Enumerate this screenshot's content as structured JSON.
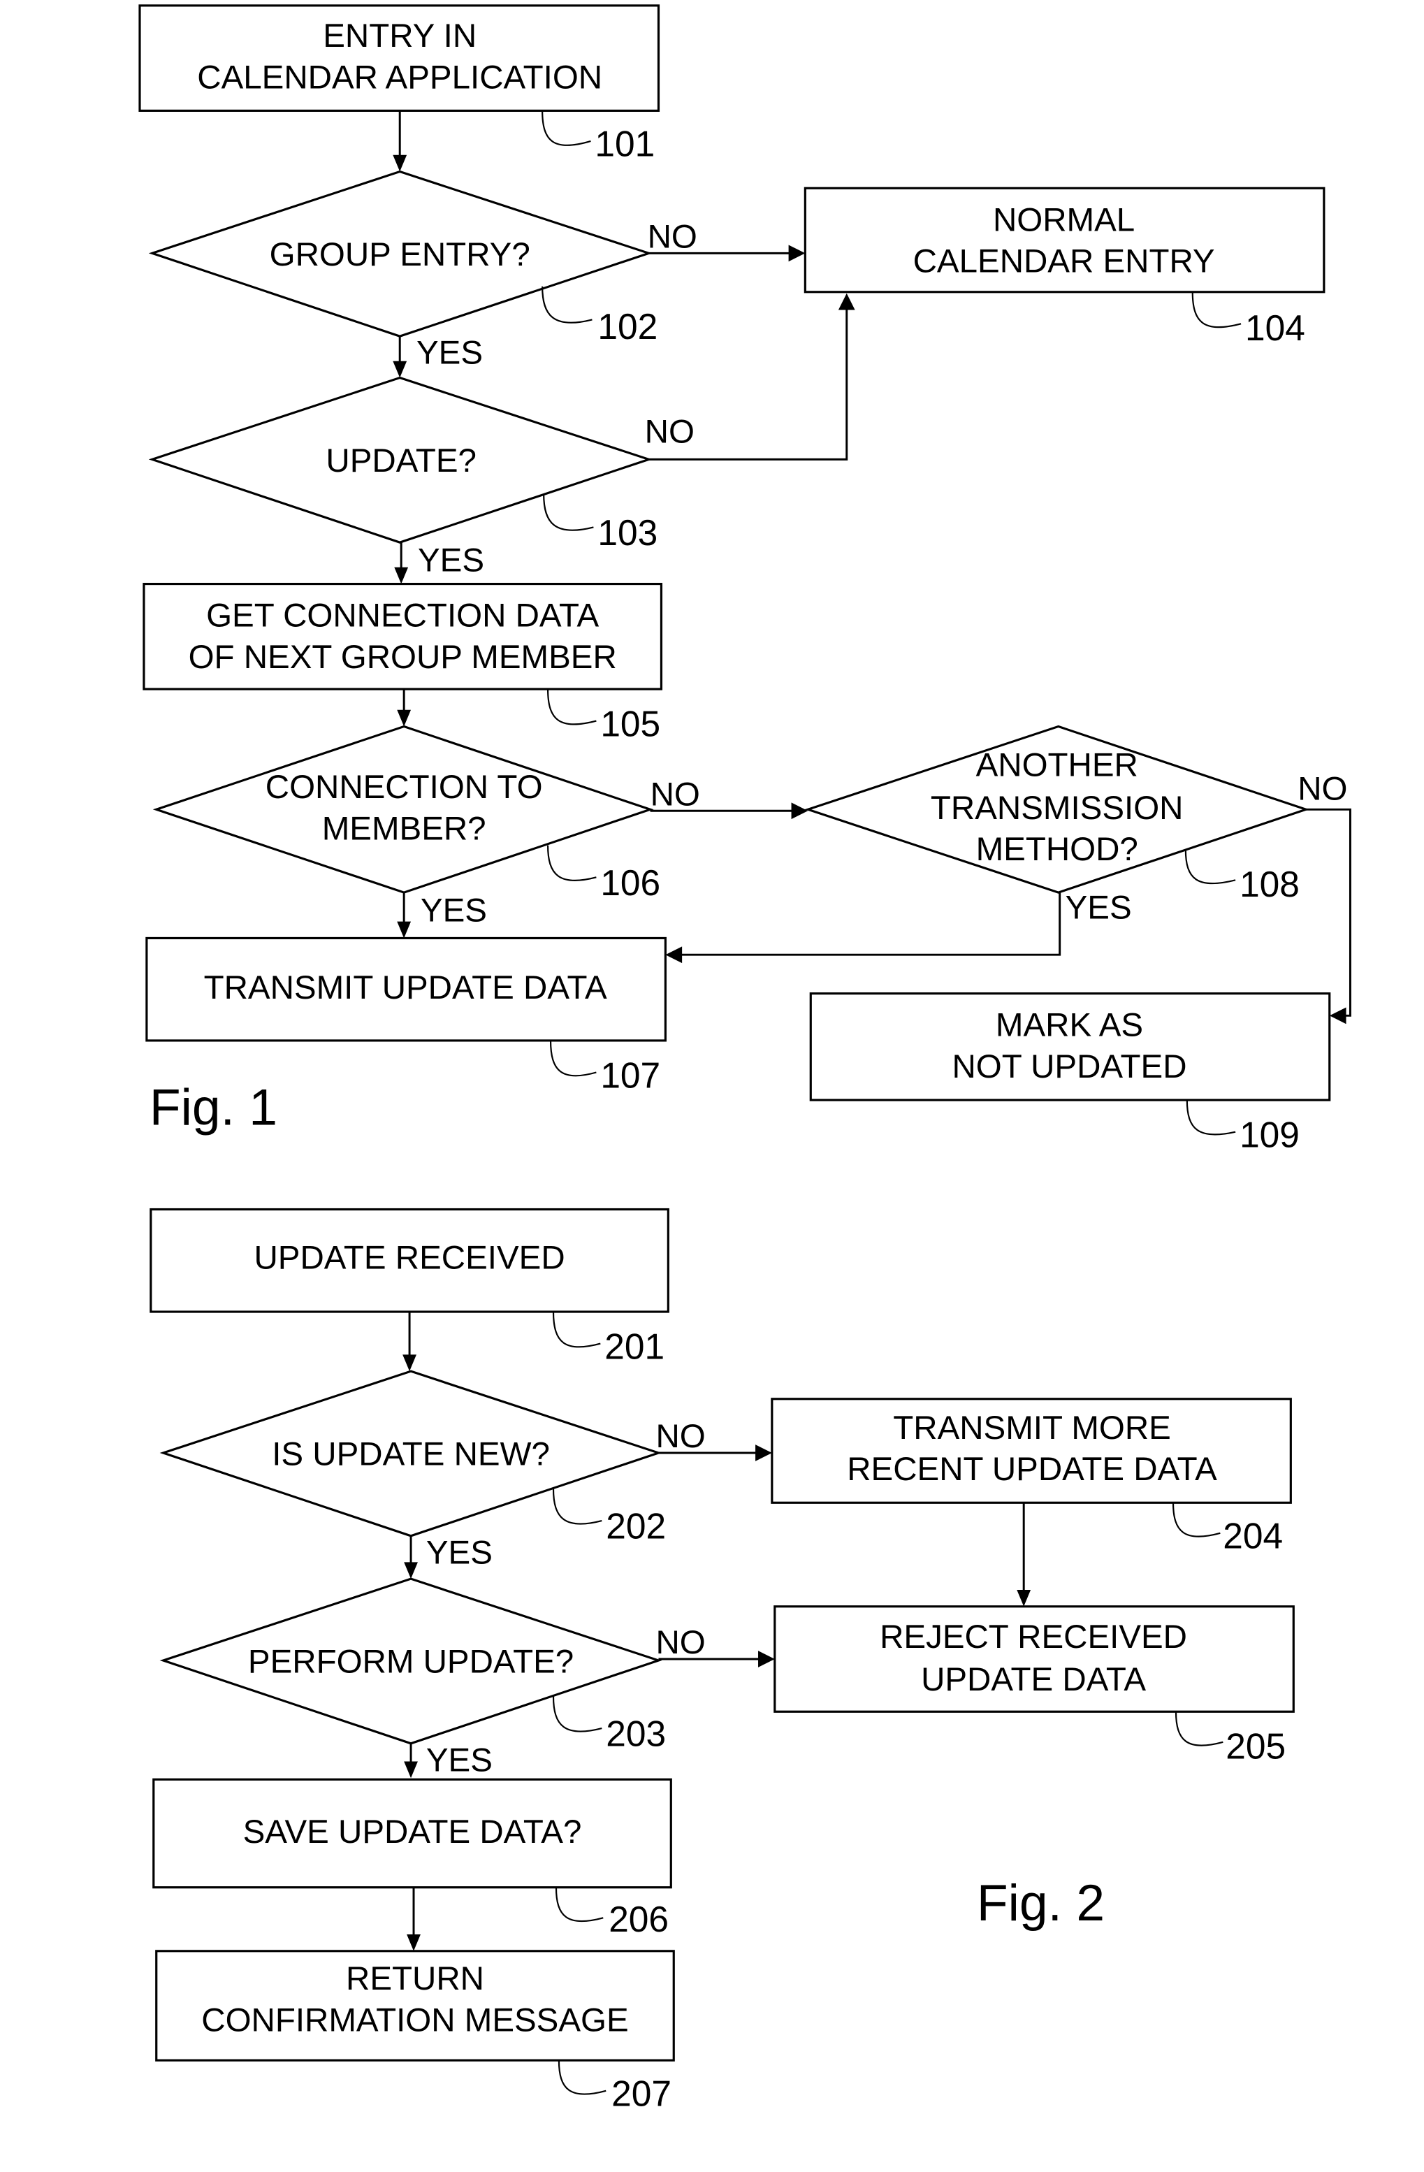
{
  "figures": [
    {
      "label": "Fig. 1",
      "nodes": {
        "n101": {
          "ref": "101",
          "type": "process",
          "lines": [
            "ENTRY IN",
            "CALENDAR APPLICATION"
          ]
        },
        "n102": {
          "ref": "102",
          "type": "decision",
          "lines": [
            "GROUP ENTRY?"
          ]
        },
        "n103": {
          "ref": "103",
          "type": "decision",
          "lines": [
            "UPDATE?"
          ]
        },
        "n104": {
          "ref": "104",
          "type": "process",
          "lines": [
            "NORMAL",
            "CALENDAR ENTRY"
          ]
        },
        "n105": {
          "ref": "105",
          "type": "process",
          "lines": [
            "GET CONNECTION DATA",
            "OF NEXT GROUP MEMBER"
          ]
        },
        "n106": {
          "ref": "106",
          "type": "decision",
          "lines": [
            "CONNECTION TO",
            "MEMBER?"
          ]
        },
        "n107": {
          "ref": "107",
          "type": "process",
          "lines": [
            "TRANSMIT UPDATE DATA"
          ]
        },
        "n108": {
          "ref": "108",
          "type": "decision",
          "lines": [
            "ANOTHER",
            "TRANSMISSION",
            "METHOD?"
          ]
        },
        "n109": {
          "ref": "109",
          "type": "process",
          "lines": [
            "MARK AS",
            "NOT UPDATED"
          ]
        }
      },
      "edges": [
        {
          "from": "101",
          "to": "102",
          "label": ""
        },
        {
          "from": "102",
          "to": "104",
          "label": "NO"
        },
        {
          "from": "102",
          "to": "103",
          "label": "YES"
        },
        {
          "from": "103",
          "to": "104",
          "label": "NO"
        },
        {
          "from": "103",
          "to": "105",
          "label": "YES"
        },
        {
          "from": "105",
          "to": "106",
          "label": ""
        },
        {
          "from": "106",
          "to": "108",
          "label": "NO"
        },
        {
          "from": "106",
          "to": "107",
          "label": "YES"
        },
        {
          "from": "108",
          "to": "107",
          "label": "YES"
        },
        {
          "from": "108",
          "to": "109",
          "label": "NO"
        }
      ]
    },
    {
      "label": "Fig. 2",
      "nodes": {
        "n201": {
          "ref": "201",
          "type": "process",
          "lines": [
            "UPDATE RECEIVED"
          ]
        },
        "n202": {
          "ref": "202",
          "type": "decision",
          "lines": [
            "IS UPDATE NEW?"
          ]
        },
        "n203": {
          "ref": "203",
          "type": "decision",
          "lines": [
            "PERFORM UPDATE?"
          ]
        },
        "n204": {
          "ref": "204",
          "type": "process",
          "lines": [
            "TRANSMIT MORE",
            "RECENT UPDATE DATA"
          ]
        },
        "n205": {
          "ref": "205",
          "type": "process",
          "lines": [
            "REJECT RECEIVED",
            "UPDATE DATA"
          ]
        },
        "n206": {
          "ref": "206",
          "type": "process",
          "lines": [
            "SAVE UPDATE DATA?"
          ]
        },
        "n207": {
          "ref": "207",
          "type": "process",
          "lines": [
            "RETURN",
            "CONFIRMATION MESSAGE"
          ]
        }
      },
      "edges": [
        {
          "from": "201",
          "to": "202",
          "label": ""
        },
        {
          "from": "202",
          "to": "204",
          "label": "NO"
        },
        {
          "from": "202",
          "to": "203",
          "label": "YES"
        },
        {
          "from": "204",
          "to": "205",
          "label": ""
        },
        {
          "from": "203",
          "to": "205",
          "label": "NO"
        },
        {
          "from": "203",
          "to": "206",
          "label": "YES"
        },
        {
          "from": "206",
          "to": "207",
          "label": ""
        }
      ]
    }
  ],
  "edge_labels": {
    "yes": "YES",
    "no": "NO"
  }
}
